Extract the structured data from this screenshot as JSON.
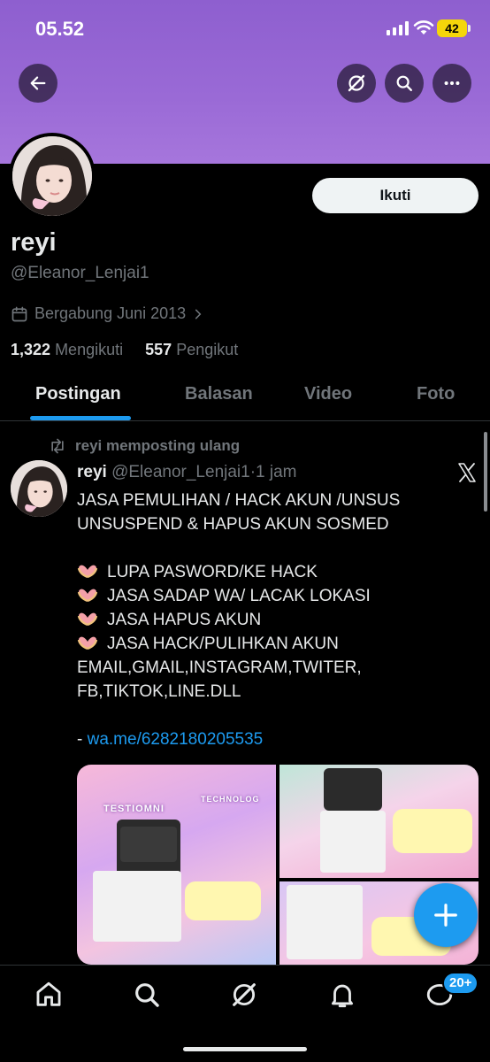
{
  "status_bar": {
    "time": "05.52",
    "battery": "42"
  },
  "profile": {
    "name": "reyi",
    "handle": "@Eleanor_Lenjai1",
    "joined": "Bergabung Juni 2013",
    "following_count": "1,322",
    "following_label": "Mengikuti",
    "followers_count": "557",
    "followers_label": "Pengikut",
    "follow_button": "Ikuti"
  },
  "tabs": [
    {
      "label": "Postingan",
      "active": true
    },
    {
      "label": "Balasan",
      "active": false
    },
    {
      "label": "Video",
      "active": false
    },
    {
      "label": "Foto",
      "active": false
    }
  ],
  "post": {
    "repost_label": "reyi memposting ulang",
    "author_name": "reyi",
    "author_handle": "@Eleanor_Lenjai1",
    "separator": "·",
    "time": "1 jam",
    "lines": {
      "l1": "JASA PEMULIHAN / HACK AKUN /UNSUS",
      "l2": "UNSUSPEND & HAPUS AKUN SOSMED",
      "l3": "LUPA PASWORD/KE HACK",
      "l4": "JASA SADAP WA/ LACAK LOKASI",
      "l5": "JASA HAPUS AKUN",
      "l6": "JASA HACK/PULIHKAN AKUN",
      "l7": "EMAIL,GMAIL,INSTAGRAM,TWITER,",
      "l8": "FB,TIKTOK,LINE.DLL",
      "dash": "- ",
      "link": "wa.me/6282180205535"
    },
    "media": {
      "title1": "TESTIOMNI",
      "title2": "TECHNOLOG"
    }
  },
  "nav_badge": "20+",
  "colors": {
    "accent": "#1d9bf0",
    "banner": "#9a6ad6",
    "background": "#000000"
  },
  "icons": [
    "back-arrow-icon",
    "grok-icon",
    "search-icon",
    "more-icon",
    "calendar-icon",
    "chevron-right-icon",
    "repost-icon",
    "x-logo-icon",
    "heart-hands-icon",
    "compose-plus-icon",
    "home-icon",
    "explore-icon",
    "grok-nav-icon",
    "notifications-icon",
    "messages-icon"
  ]
}
